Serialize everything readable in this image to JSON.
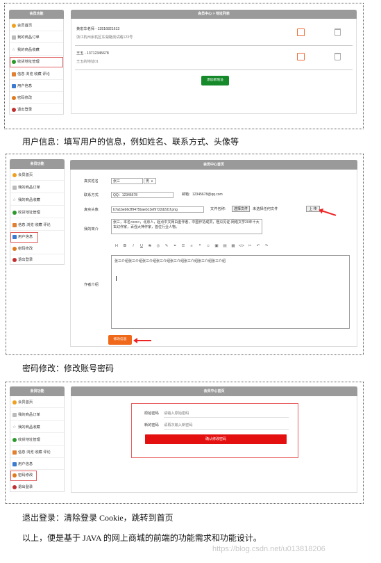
{
  "sidebar": {
    "title": "会员功能",
    "items": [
      {
        "label": "会员首页",
        "icon": "home-icon",
        "color": "#f0a020"
      },
      {
        "label": "我的商品订单",
        "icon": "order-icon",
        "color": "#9aa"
      },
      {
        "label": "我的商品收藏",
        "icon": "star-icon",
        "color": "#9aa"
      },
      {
        "label": "收货地址管理",
        "icon": "location-icon",
        "color": "#2a9a2a"
      },
      {
        "label": "信息 浏览 收藏 评论",
        "icon": "comment-icon",
        "color": "#e08030"
      },
      {
        "label": "用户信息",
        "icon": "user-icon",
        "color": "#3a7ad0"
      },
      {
        "label": "密码修改",
        "icon": "lock-icon",
        "color": "#e07a20"
      },
      {
        "label": "退出登录",
        "icon": "logout-icon",
        "color": "#c03030"
      }
    ]
  },
  "section1": {
    "header": "会员中心 > 地址列表",
    "addresses": [
      {
        "name_phone": "黄宏华老师 - 13516821613",
        "address": "浙江杭州余杭区东湖路测试路123号"
      },
      {
        "name_phone": "王五 - 13712345678",
        "address": "王五的地址01"
      }
    ],
    "add_button": "添加新地址",
    "caption": "用户信息：填写用户的信息，例如姓名、联系方式、头像等"
  },
  "section2": {
    "header": "会员中心首页",
    "real_name_label": "真实姓名",
    "real_name_value": "张三",
    "gender_value": "男",
    "contact_label": "联系方式",
    "qq_value": "QQ：12345678",
    "email_value": "邮箱：12345678@qq.com",
    "avatar_label": "真实头像",
    "avatar_value": "b7a1beb6cff9475baeb13ef9722d2d1f.png",
    "file_label": "文件名称:",
    "choose_file": "选择文件",
    "no_file": "未选择任何文件",
    "upload_button": "上 传",
    "intro_label": "我的简介",
    "intro_text": "张三，本名&lt;xxx&gt;，北京人，起点中文网白金作者，中国作协成员，橙瓜见证·网络文学20年十大玄幻作家，百强大神作家，首位行业人物。",
    "author_label": "作者介绍",
    "author_text": "张三介绍张三介绍张三介绍张三介绍张三介绍张三介绍张三介绍张三介绍",
    "save_button": "修改信息",
    "caption": "密码修改：修改账号密码"
  },
  "section3": {
    "header": "会员中心首页",
    "old_label": "原始密码",
    "old_placeholder": "请输入原始密码",
    "new_label": "新的密码",
    "new_placeholder": "请再次输入新密码",
    "confirm_button": "确认修改密码"
  },
  "footer": {
    "line1": "退出登录：清除登录 Cookie，跳转到首页",
    "line2": "以上，便是基于 JAVA 的网上商城的前端的功能需求和功能设计。",
    "watermark": "https://blog.csdn.net/u013818206"
  },
  "colors": {
    "accent_red": "#e22222",
    "green": "#168a2a",
    "orange": "#f0691a",
    "header_gray": "#9a9a9a"
  }
}
